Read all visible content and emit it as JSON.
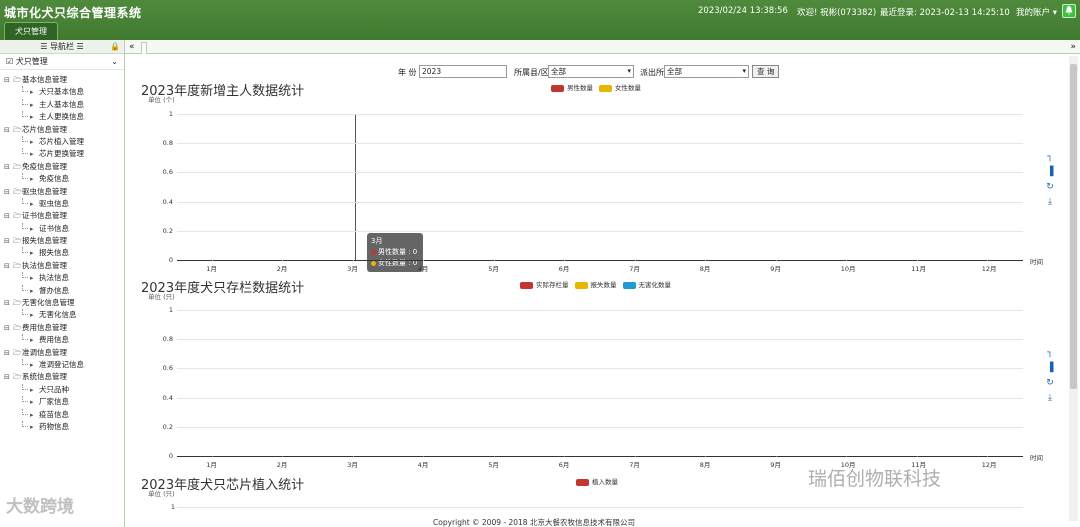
{
  "header": {
    "app_title": "城市化犬只综合管理系统",
    "tab": "犬只管理",
    "datetime": "2023/02/24 13:38:56",
    "welcome": "欢迎! 祝彬(073382)",
    "last_login": "最近登录: 2023-02-13 14:25:10",
    "account": "我的账户 ▾",
    "user_icon": "bell-icon"
  },
  "sidebar": {
    "nav_title": "☰ 导航栏 ☰",
    "module": "犬只管理",
    "tree": [
      {
        "label": "基本信息管理",
        "children": [
          "犬只基本信息",
          "主人基本信息",
          "主人更换信息"
        ]
      },
      {
        "label": "芯片信息管理",
        "children": [
          "芯片植入管理",
          "芯片更换管理"
        ]
      },
      {
        "label": "免疫信息管理",
        "children": [
          "免疫信息"
        ]
      },
      {
        "label": "驱虫信息管理",
        "children": [
          "驱虫信息"
        ]
      },
      {
        "label": "证书信息管理",
        "children": [
          "证书信息"
        ]
      },
      {
        "label": "报失信息管理",
        "children": [
          "报失信息"
        ]
      },
      {
        "label": "执法信息管理",
        "children": [
          "执法信息",
          "督办信息"
        ]
      },
      {
        "label": "无害化信息管理",
        "children": [
          "无害化信息"
        ]
      },
      {
        "label": "费用信息管理",
        "children": [
          "费用信息"
        ]
      },
      {
        "label": "准调信息管理",
        "children": [
          "准调登记信息"
        ]
      },
      {
        "label": "系统信息管理",
        "children": [
          "犬只品种",
          "厂家信息",
          "疫苗信息",
          "药物信息"
        ]
      }
    ]
  },
  "filter": {
    "year_label": "年 份",
    "year_value": "2023",
    "district_label": "所属县/区",
    "district_value": "全部",
    "station_label": "派出所",
    "station_value": "全部",
    "query_button": "查 询"
  },
  "colors": {
    "red": "#c23531",
    "yellow": "#e6b600",
    "blue": "#1f9bd1",
    "header_green": "#4a8438"
  },
  "chart_data": [
    {
      "type": "line",
      "title": "2023年度新增主人数据统计",
      "unit": "单位 (个)",
      "xlabel": "时间",
      "categories": [
        "1月",
        "2月",
        "3月",
        "4月",
        "5月",
        "6月",
        "7月",
        "8月",
        "9月",
        "10月",
        "11月",
        "12月"
      ],
      "ylim": [
        0,
        1
      ],
      "yticks": [
        "0",
        "0.2",
        "0.4",
        "0.6",
        "0.8",
        "1"
      ],
      "series": [
        {
          "name": "男性数量",
          "color": "#c23531",
          "values": [
            0,
            0,
            0,
            0,
            0,
            0,
            0,
            0,
            0,
            0,
            0,
            0
          ]
        },
        {
          "name": "女性数量",
          "color": "#e6b600",
          "values": [
            0,
            0,
            0,
            0,
            0,
            0,
            0,
            0,
            0,
            0,
            0,
            0
          ]
        }
      ],
      "tooltip": {
        "title": "3月",
        "lines": [
          "男性数量 : 0",
          "女性数量 : 0"
        ]
      }
    },
    {
      "type": "line",
      "title": "2023年度犬只存栏数据统计",
      "unit": "单位 (只)",
      "xlabel": "时间",
      "categories": [
        "1月",
        "2月",
        "3月",
        "4月",
        "5月",
        "6月",
        "7月",
        "8月",
        "9月",
        "10月",
        "11月",
        "12月"
      ],
      "ylim": [
        0,
        1
      ],
      "yticks": [
        "0",
        "0.2",
        "0.4",
        "0.6",
        "0.8",
        "1"
      ],
      "series": [
        {
          "name": "实际存栏量",
          "color": "#c23531",
          "values": [
            0,
            0,
            0,
            0,
            0,
            0,
            0,
            0,
            0,
            0,
            0,
            0
          ]
        },
        {
          "name": "报失数量",
          "color": "#e6b600",
          "values": [
            0,
            0,
            0,
            0,
            0,
            0,
            0,
            0,
            0,
            0,
            0,
            0
          ]
        },
        {
          "name": "无害化数量",
          "color": "#1f9bd1",
          "values": [
            0,
            0,
            0,
            0,
            0,
            0,
            0,
            0,
            0,
            0,
            0,
            0
          ]
        }
      ]
    },
    {
      "type": "line",
      "title": "2023年度犬只芯片植入统计",
      "unit": "单位 (只)",
      "yticks": [
        "1"
      ],
      "series": [
        {
          "name": "植入数量",
          "color": "#c23531",
          "values": []
        }
      ]
    }
  ],
  "toolbox_icons": [
    "line-chart-icon",
    "bar-chart-icon",
    "refresh-icon",
    "download-icon"
  ],
  "footer": "Copyright © 2009 - 2018 北京大餐农牧信息技术有限公司",
  "watermarks": [
    "大数跨境",
    "瑞佰创物联科技"
  ]
}
